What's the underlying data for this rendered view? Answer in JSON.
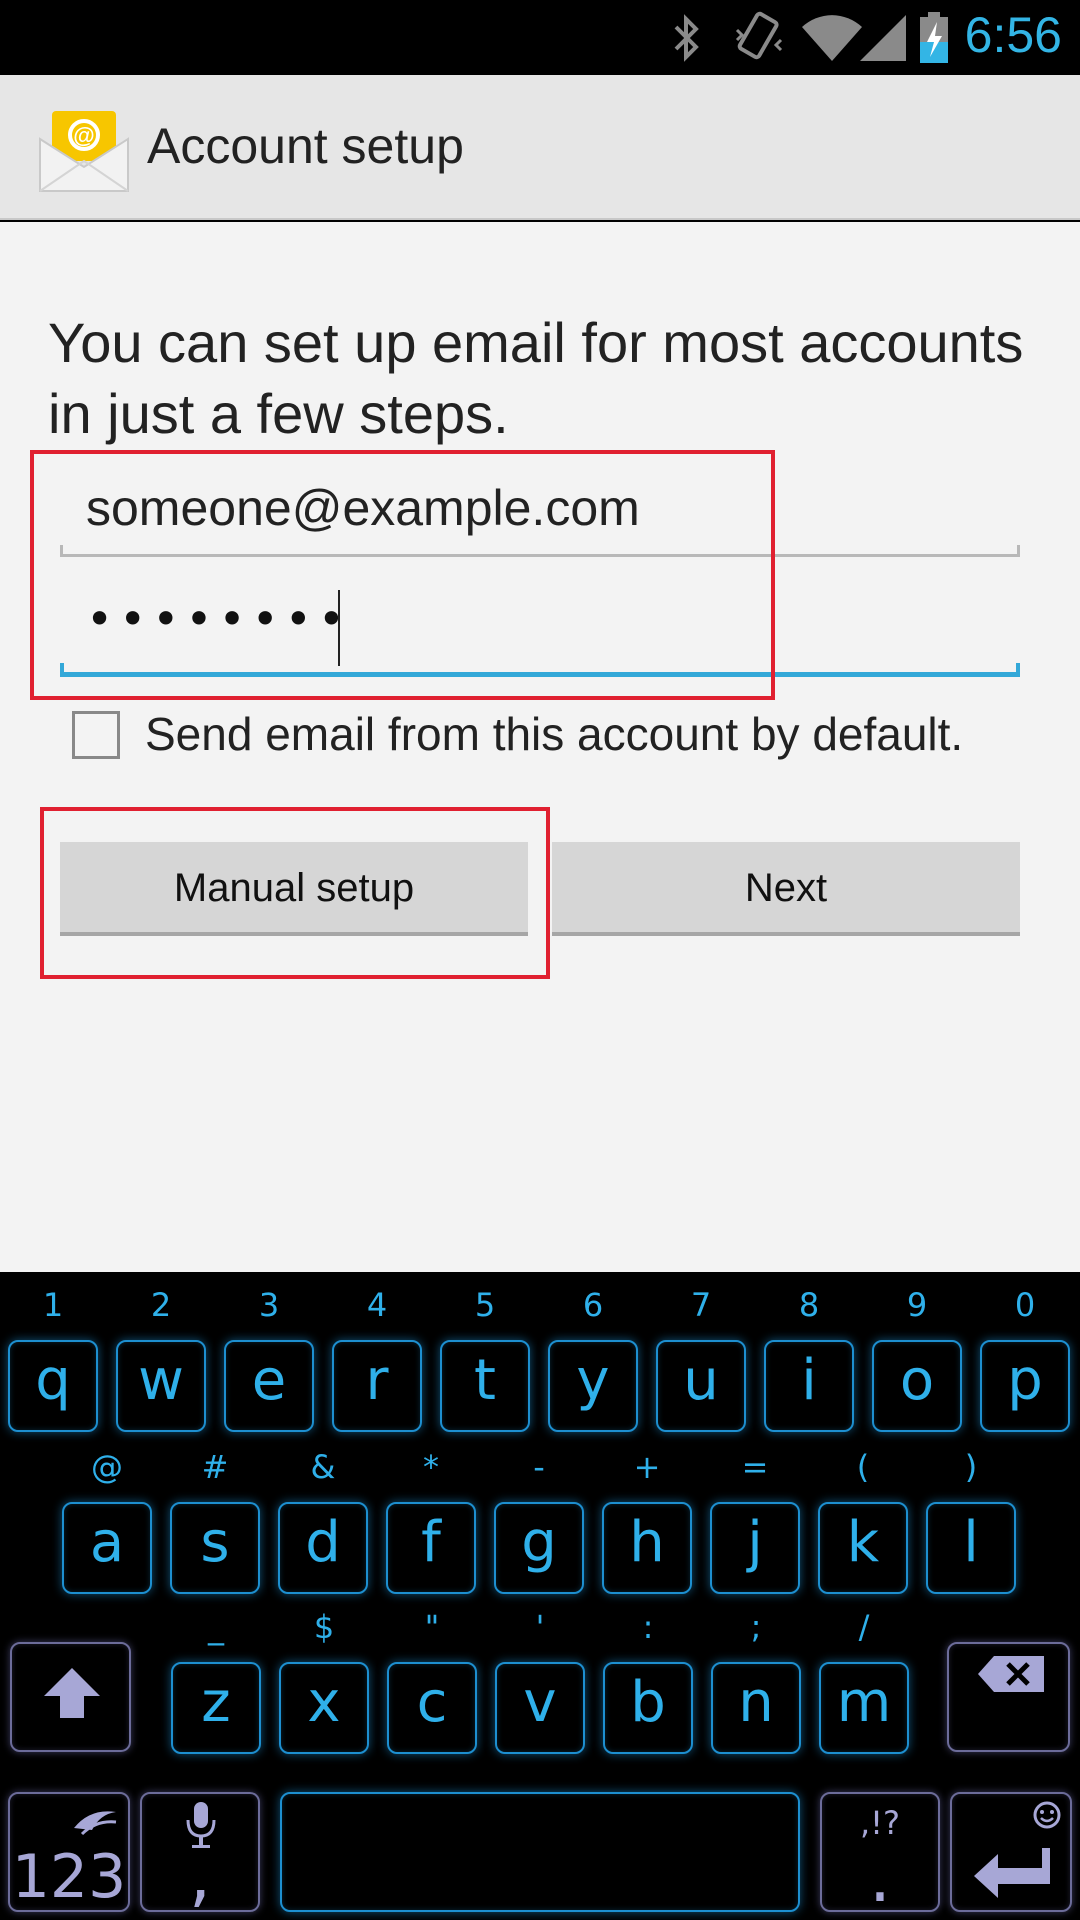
{
  "status_bar": {
    "time": "6:56",
    "icons": [
      "bluetooth-icon",
      "vibrate-icon",
      "wifi-icon",
      "signal-icon",
      "battery-charging-icon"
    ]
  },
  "action_bar": {
    "title": "Account setup",
    "icon": "email-app-icon"
  },
  "form": {
    "intro": "You can set up email for most accounts in just a few steps.",
    "email_value": "someone@example.com",
    "password_value": "••••••••",
    "default_checkbox_label": "Send email from this account by default.",
    "default_checkbox_checked": false,
    "manual_setup_label": "Manual setup",
    "next_label": "Next"
  },
  "keyboard": {
    "row1": [
      {
        "main": "q",
        "hint": "1"
      },
      {
        "main": "w",
        "hint": "2"
      },
      {
        "main": "e",
        "hint": "3"
      },
      {
        "main": "r",
        "hint": "4"
      },
      {
        "main": "t",
        "hint": "5"
      },
      {
        "main": "y",
        "hint": "6"
      },
      {
        "main": "u",
        "hint": "7"
      },
      {
        "main": "i",
        "hint": "8"
      },
      {
        "main": "o",
        "hint": "9"
      },
      {
        "main": "p",
        "hint": "0"
      }
    ],
    "row2": [
      {
        "main": "a",
        "hint": "@"
      },
      {
        "main": "s",
        "hint": "#"
      },
      {
        "main": "d",
        "hint": "&"
      },
      {
        "main": "f",
        "hint": "*"
      },
      {
        "main": "g",
        "hint": "-"
      },
      {
        "main": "h",
        "hint": "+"
      },
      {
        "main": "j",
        "hint": "="
      },
      {
        "main": "k",
        "hint": "("
      },
      {
        "main": "l",
        "hint": ")"
      }
    ],
    "row3": [
      {
        "main": "z",
        "hint": "_"
      },
      {
        "main": "x",
        "hint": "$"
      },
      {
        "main": "c",
        "hint": "\""
      },
      {
        "main": "v",
        "hint": "'"
      },
      {
        "main": "b",
        "hint": ":"
      },
      {
        "main": "n",
        "hint": ";"
      },
      {
        "main": "m",
        "hint": "/"
      }
    ],
    "numbers_label": "123",
    "comma_label": ",",
    "period_label": ".",
    "period_hint": ",!?",
    "icons": [
      "shift-icon",
      "backspace-icon",
      "swiftkey-icon",
      "microphone-icon",
      "emoji-icon",
      "enter-icon"
    ]
  }
}
